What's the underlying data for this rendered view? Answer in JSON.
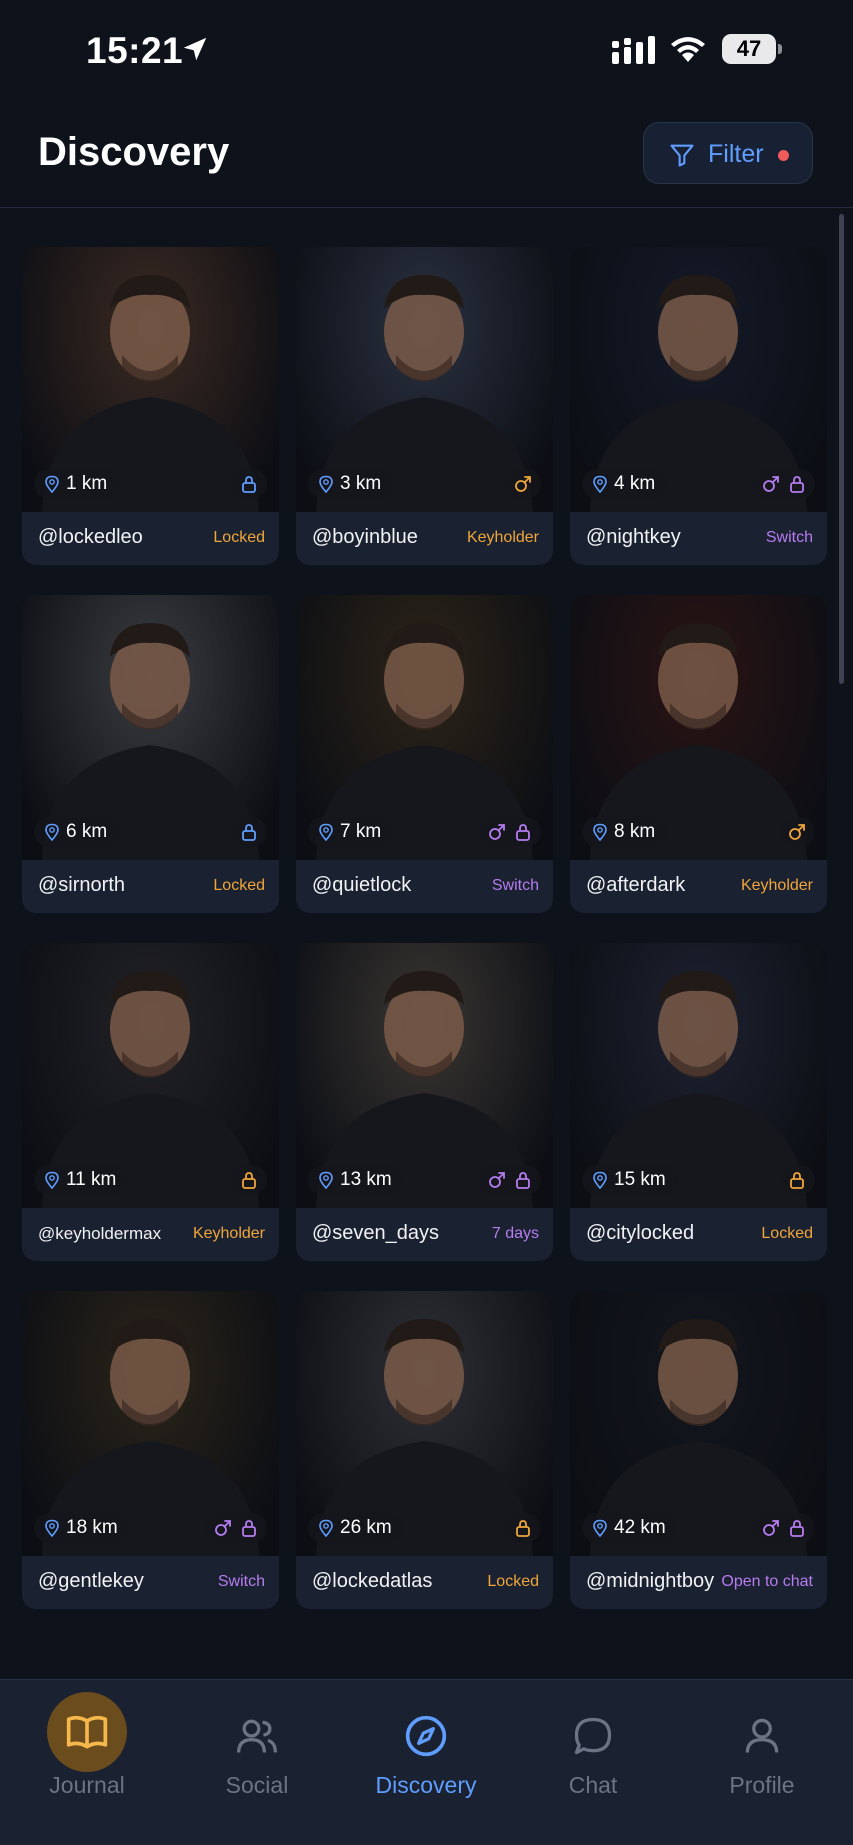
{
  "status_bar": {
    "time": "15:21",
    "battery": "47"
  },
  "header": {
    "title": "Discovery",
    "filter_label": "Filter"
  },
  "cards": [
    {
      "distance": "1 km",
      "handle": "@lockedleo",
      "role": "Locked",
      "role_color": "amber",
      "icons": [
        "lock-blue"
      ],
      "tone": "#3b2a22"
    },
    {
      "distance": "3 km",
      "handle": "@boyinblue",
      "role": "Keyholder",
      "role_color": "amber",
      "icons": [
        "male-amber"
      ],
      "tone": "#2a3140"
    },
    {
      "distance": "4 km",
      "handle": "@nightkey",
      "role": "Switch",
      "role_color": "purple",
      "icons": [
        "male-purple",
        "lock-purple"
      ],
      "tone": "#141a28"
    },
    {
      "distance": "6 km",
      "handle": "@sirnorth",
      "role": "Locked",
      "role_color": "amber",
      "icons": [
        "lock-blue"
      ],
      "tone": "#3a3c40"
    },
    {
      "distance": "7 km",
      "handle": "@quietlock",
      "role": "Switch",
      "role_color": "purple",
      "icons": [
        "male-purple",
        "lock-purple"
      ],
      "tone": "#2c2418"
    },
    {
      "distance": "8 km",
      "handle": "@afterdark",
      "role": "Keyholder",
      "role_color": "amber",
      "icons": [
        "male-amber"
      ],
      "tone": "#2a1414"
    },
    {
      "distance": "11 km",
      "handle": "@keyholdermax",
      "role": "Keyholder",
      "role_color": "amber",
      "icons": [
        "lock-amber"
      ],
      "tone": "#222226"
    },
    {
      "distance": "13 km",
      "handle": "@seven_days",
      "role": "7 days",
      "role_color": "purple",
      "icons": [
        "male-purple",
        "lock-purple"
      ],
      "tone": "#3a3632"
    },
    {
      "distance": "15 km",
      "handle": "@citylocked",
      "role": "Locked",
      "role_color": "amber",
      "icons": [
        "lock-amber"
      ],
      "tone": "#1e2230"
    },
    {
      "distance": "18 km",
      "handle": "@gentlekey",
      "role": "Switch",
      "role_color": "purple",
      "icons": [
        "male-purple",
        "lock-purple"
      ],
      "tone": "#2a241a"
    },
    {
      "distance": "26 km",
      "handle": "@lockedatlas",
      "role": "Locked",
      "role_color": "amber",
      "icons": [
        "lock-amber"
      ],
      "tone": "#2e3036"
    },
    {
      "distance": "42 km",
      "handle": "@midnightboy",
      "role": "Open to chat",
      "role_color": "purple",
      "icons": [
        "male-purple",
        "lock-purple"
      ],
      "tone": "#14161e"
    }
  ],
  "tabs": [
    {
      "id": "journal",
      "label": "Journal",
      "icon": "book-icon"
    },
    {
      "id": "social",
      "label": "Social",
      "icon": "people-icon"
    },
    {
      "id": "discovery",
      "label": "Discovery",
      "icon": "compass-icon",
      "active": true
    },
    {
      "id": "chat",
      "label": "Chat",
      "icon": "chat-bubble-icon"
    },
    {
      "id": "profile",
      "label": "Profile",
      "icon": "person-icon"
    }
  ],
  "colors": {
    "accent_blue": "#5f9dff",
    "amber": "#f0a63a",
    "purple": "#b67cf0",
    "notification_red": "#ef5a5a"
  }
}
